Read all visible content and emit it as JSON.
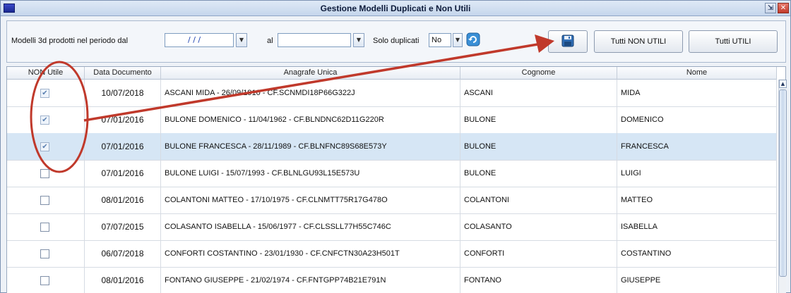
{
  "window": {
    "title": "Gestione Modelli Duplicati e Non Utili",
    "restore_glyph": "⇲",
    "close_glyph": "✕"
  },
  "toolbar": {
    "period_label": "Modelli 3d prodotti nel periodo dal",
    "from_value": "/ / /",
    "to_label": "al",
    "to_value": "",
    "only_duplicates_label": "Solo duplicati",
    "only_duplicates_value": "No",
    "save_label": "",
    "all_non_useful_label": "Tutti NON UTILI",
    "all_useful_label": "Tutti UTILI"
  },
  "grid": {
    "columns": [
      "NON Utile",
      "Data Documento",
      "Anagrafe Unica",
      "Cognome",
      "Nome"
    ],
    "rows": [
      {
        "non_utile": true,
        "data": "10/07/2018",
        "anagrafe": "ASCANI MIDA - 26/09/1910 - CF.SCNMDI18P66G322J",
        "cognome": "ASCANI",
        "nome": "MIDA"
      },
      {
        "non_utile": true,
        "data": "07/01/2016",
        "anagrafe": "BULONE DOMENICO - 11/04/1962 - CF.BLNDNC62D11G220R",
        "cognome": "BULONE",
        "nome": "DOMENICO"
      },
      {
        "non_utile": true,
        "data": "07/01/2016",
        "anagrafe": "BULONE FRANCESCA - 28/11/1989 - CF.BLNFNC89S68E573Y",
        "cognome": "BULONE",
        "nome": "FRANCESCA"
      },
      {
        "non_utile": false,
        "data": "07/01/2016",
        "anagrafe": "BULONE LUIGI - 15/07/1993 - CF.BLNLGU93L15E573U",
        "cognome": "BULONE",
        "nome": "LUIGI"
      },
      {
        "non_utile": false,
        "data": "08/01/2016",
        "anagrafe": "COLANTONI MATTEO - 17/10/1975 - CF.CLNMTT75R17G478O",
        "cognome": "COLANTONI",
        "nome": "MATTEO"
      },
      {
        "non_utile": false,
        "data": "07/07/2015",
        "anagrafe": "COLASANTO ISABELLA - 15/06/1977 - CF.CLSSLL77H55C746C",
        "cognome": "COLASANTO",
        "nome": "ISABELLA"
      },
      {
        "non_utile": false,
        "data": "06/07/2018",
        "anagrafe": "CONFORTI COSTANTINO - 23/01/1930 - CF.CNFCTN30A23H501T",
        "cognome": "CONFORTI",
        "nome": "COSTANTINO"
      },
      {
        "non_utile": false,
        "data": "08/01/2016",
        "anagrafe": "FONTANO GIUSEPPE - 21/02/1974 - CF.FNTGPP74B21E791N",
        "cognome": "FONTANO",
        "nome": "GIUSEPPE"
      }
    ],
    "selected_row": 2
  },
  "annotation": {
    "color": "#c0392b"
  }
}
